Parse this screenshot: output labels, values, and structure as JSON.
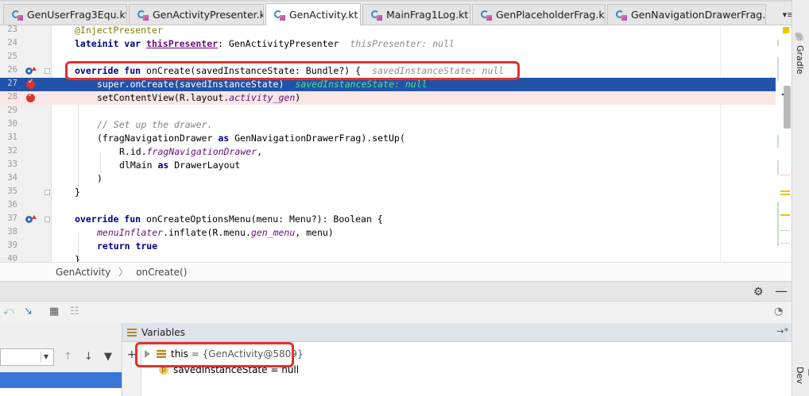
{
  "tabs": [
    {
      "label": "GenUserFrag3Equ.kt",
      "active": false
    },
    {
      "label": "GenActivityPresenter.kt",
      "active": false
    },
    {
      "label": "GenActivity.kt",
      "active": true
    },
    {
      "label": "MainFrag1Log.kt",
      "active": false
    },
    {
      "label": "GenPlaceholderFrag.kt",
      "active": false
    },
    {
      "label": "GenNavigationDrawerFrag.kt",
      "active": false
    }
  ],
  "tab_close_glyph": "×",
  "tab_overflow": "▾≡",
  "code": {
    "l23": {
      "num": "23",
      "annotation": "@InjectPresenter"
    },
    "l24": {
      "num": "24",
      "kw1": "lateinit var",
      "field": "thisPresenter",
      "rest": ": GenActivityPresenter",
      "hint": "thisPresenter: null"
    },
    "l25": {
      "num": "25"
    },
    "l26": {
      "num": "26",
      "kw": "override fun",
      "rest": " onCreate(savedInstanceState: Bundle?) {",
      "hint": "savedInstanceState: null"
    },
    "l27": {
      "num": "27",
      "text": "super.onCreate(savedInstanceState)",
      "hint": "savedInstanceState: null"
    },
    "l28": {
      "num": "28",
      "pre": "setContentView(R.layout.",
      "field": "activity_gen",
      "post": ")"
    },
    "l29": {
      "num": "29"
    },
    "l30": {
      "num": "30",
      "comment": "// Set up the drawer."
    },
    "l31": {
      "num": "31",
      "pre": "(fragNavigationDrawer ",
      "kw": "as",
      "post": " GenNavigationDrawerFrag).setUp("
    },
    "l32": {
      "num": "32",
      "pre": "R.id.",
      "field": "fragNavigationDrawer",
      "post": ","
    },
    "l33": {
      "num": "33",
      "pre": "dlMain ",
      "kw": "as",
      "post": " DrawerLayout"
    },
    "l34": {
      "num": "34",
      "text": ")"
    },
    "l35": {
      "num": "35",
      "text": "}"
    },
    "l36": {
      "num": "36"
    },
    "l37": {
      "num": "37",
      "kw": "override fun",
      "rest": " onCreateOptionsMenu(menu: Menu?): Boolean {"
    },
    "l38": {
      "num": "38",
      "field": "menuInflater",
      "pre": ".inflate(R.menu.",
      "field2": "gen_menu",
      "post": ", menu)"
    },
    "l39": {
      "num": "39",
      "kw": "return true"
    },
    "l40": {
      "num": "40",
      "text": "}"
    }
  },
  "breadcrumb": {
    "class_name": "GenActivity",
    "method_name": "onCreate()",
    "separator": "〉"
  },
  "right_sidebar": {
    "top_label": "Gradle",
    "bottom_label": "Dev"
  },
  "variables": {
    "title": "Variables",
    "this_name": "this",
    "this_value": "= {GenActivity@5809}",
    "param_icon": "p",
    "param_name": "savedInstanceState",
    "param_value": "= null"
  },
  "colors": {
    "exec_line": "#2253a8",
    "breakpoint_line": "#fbe6e6",
    "callout": "#e0322b",
    "selected_frame": "#3875d7"
  }
}
